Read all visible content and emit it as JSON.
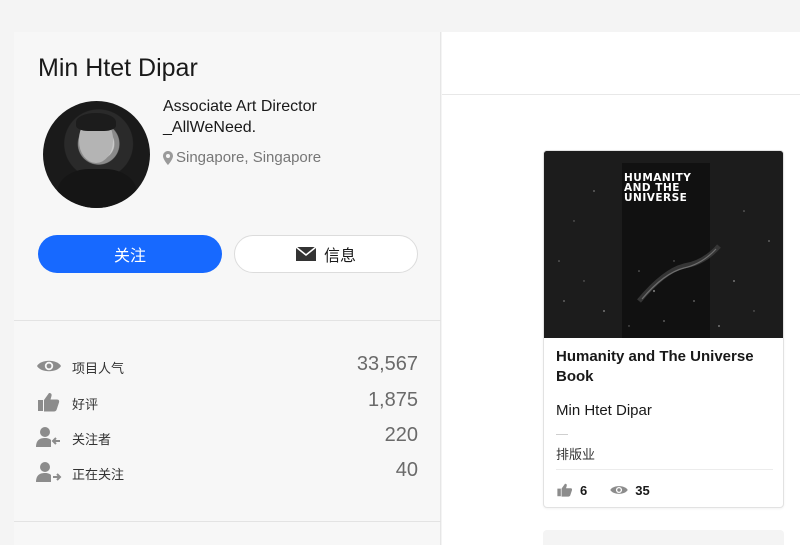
{
  "profile": {
    "name": "Min Htet Dipar",
    "occupation_line1": "Associate Art Director",
    "occupation_line2": "_AllWeNeed.",
    "location": "Singapore, Singapore"
  },
  "buttons": {
    "follow_label": "关注",
    "message_label": "信息"
  },
  "stats": [
    {
      "icon": "eye-icon",
      "label": "项目人气",
      "value": "33,567"
    },
    {
      "icon": "thumbs-up-icon",
      "label": "好评",
      "value": "1,875"
    },
    {
      "icon": "user-followers-icon",
      "label": "关注者",
      "value": "220"
    },
    {
      "icon": "user-following-icon",
      "label": "正在关注",
      "value": "40"
    }
  ],
  "project_card": {
    "cover_title": "HUMANITY\nAND THE\nUNIVERSE",
    "title": "Humanity and The Universe Book",
    "owner": "Min Htet Dipar",
    "field": "排版业",
    "appreciations": "6",
    "views": "35"
  },
  "colors": {
    "accent": "#1769ff",
    "icon_gray": "#8c8c8c"
  }
}
